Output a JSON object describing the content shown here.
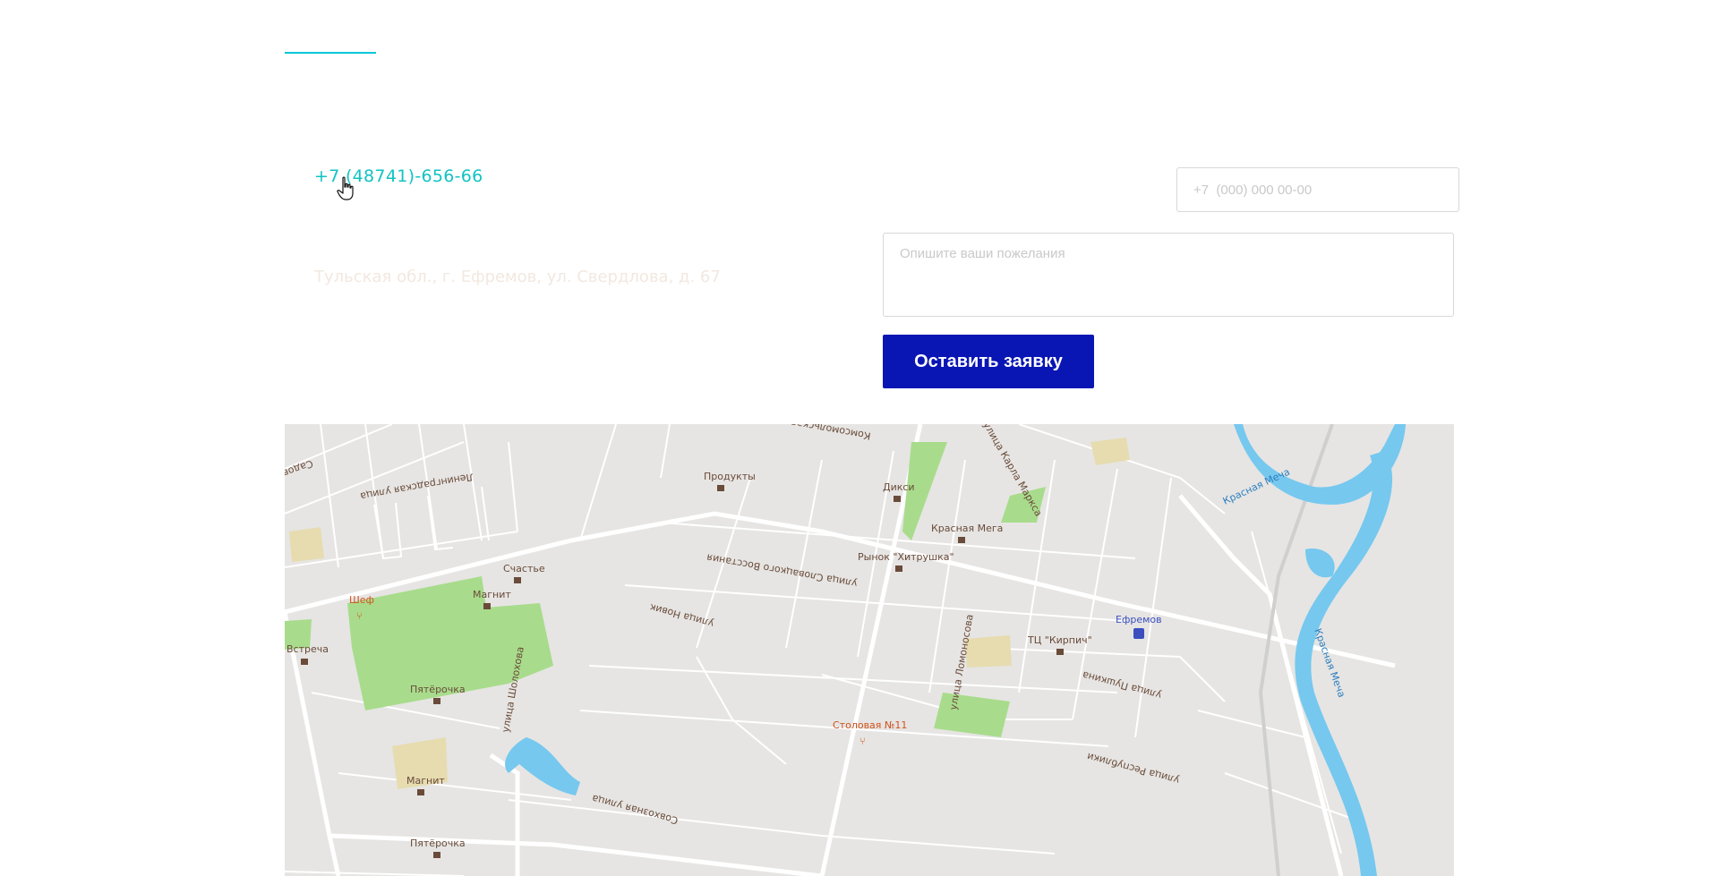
{
  "contacts": {
    "phone": "+7 (48741)-656-66",
    "address": "Тульская обл., г. Ефремов, ул. Свердлова, д. 67"
  },
  "form": {
    "phone_placeholder": "+7  (000) 000 00-00",
    "wishes_placeholder": "Опишите ваши пожелания",
    "submit_label": "Оставить заявку"
  },
  "colors": {
    "accent": "#12c3c3",
    "button": "#0a16b4",
    "park": "#a8dc8c",
    "water": "#76c8ef",
    "map_bg": "#e6e5e3"
  },
  "map": {
    "streets": [
      "Садовая улица",
      "Ленинградская улица",
      "Комсомольская улица",
      "улица Карла Маркса",
      "улица Словацкого Восстания",
      "улица Новик",
      "улица Ломоносова",
      "улица Пушкина",
      "улица Республики",
      "Совхозная улица",
      "улица Шолохова"
    ],
    "pois": [
      {
        "name": "Продукты",
        "type": "shop"
      },
      {
        "name": "Дикси",
        "type": "shop"
      },
      {
        "name": "Красная Мега",
        "type": "shop"
      },
      {
        "name": "Рынок \"Хитрушка\"",
        "type": "shop"
      },
      {
        "name": "Счастье",
        "type": "shop"
      },
      {
        "name": "Магнит",
        "type": "shop"
      },
      {
        "name": "Шеф",
        "type": "food"
      },
      {
        "name": "Встреча",
        "type": "shop"
      },
      {
        "name": "Пятёрочка",
        "type": "shop"
      },
      {
        "name": "ТЦ \"Кирпич\"",
        "type": "shop"
      },
      {
        "name": "Столовая №11",
        "type": "food"
      },
      {
        "name": "Ефремов",
        "type": "station"
      },
      {
        "name": "Красная Меча",
        "type": "river"
      }
    ]
  }
}
